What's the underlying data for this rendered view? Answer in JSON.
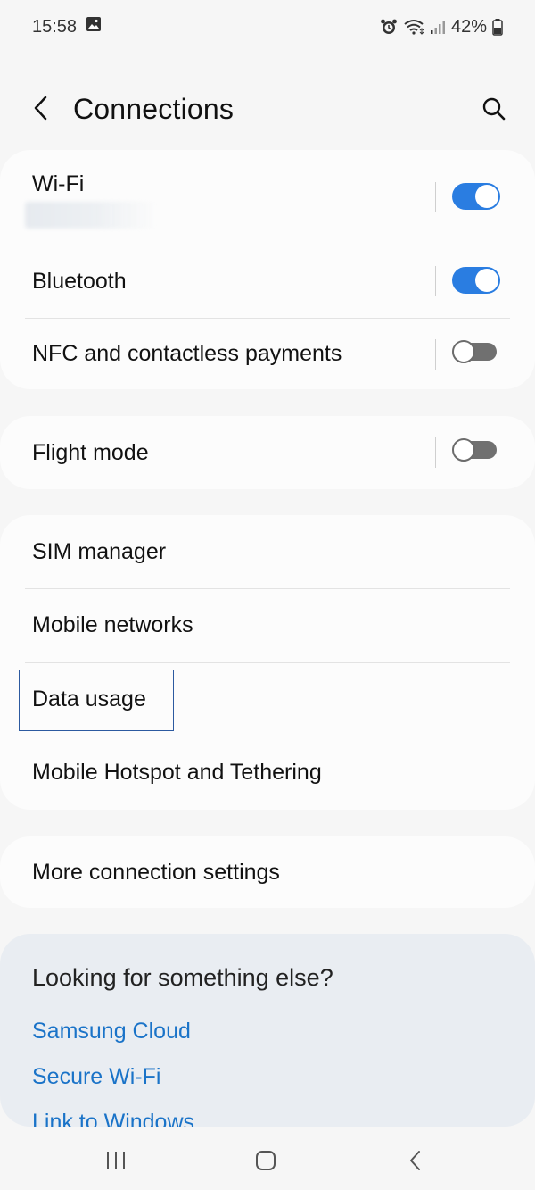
{
  "status_bar": {
    "time": "15:58",
    "battery_percent": "42%"
  },
  "header": {
    "title": "Connections"
  },
  "connectivity": {
    "wifi_label": "Wi-Fi",
    "wifi_on": true,
    "bluetooth_label": "Bluetooth",
    "bluetooth_on": true,
    "nfc_label": "NFC and contactless payments",
    "nfc_on": false
  },
  "flight": {
    "label": "Flight mode",
    "on": false
  },
  "network": {
    "items": [
      {
        "label": "SIM manager"
      },
      {
        "label": "Mobile networks"
      },
      {
        "label": "Data usage"
      },
      {
        "label": "Mobile Hotspot and Tethering"
      }
    ]
  },
  "more": {
    "label": "More connection settings"
  },
  "suggestions": {
    "title": "Looking for something else?",
    "links": [
      {
        "label": "Samsung Cloud"
      },
      {
        "label": "Secure Wi-Fi"
      },
      {
        "label": "Link to Windows"
      }
    ]
  },
  "colors": {
    "accent": "#2a7de1",
    "link": "#1a73c8",
    "background": "#f6f6f6",
    "card": "#fcfcfc"
  }
}
